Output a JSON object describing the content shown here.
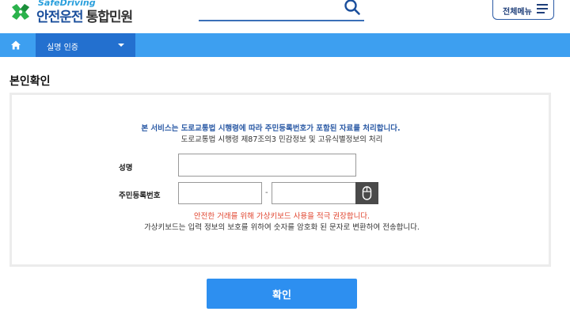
{
  "header": {
    "logo_en": "SafeDriving",
    "logo_ko": "안전운전",
    "logo_sub": "통합민원",
    "search": {
      "value": "",
      "placeholder": ""
    },
    "menu_label": "전체메뉴"
  },
  "nav": {
    "home_icon": "home-icon",
    "selected": "실명 인증"
  },
  "page": {
    "title": "본인확인"
  },
  "form": {
    "notice_primary": "본 서비스는 도로교통법 시행령에 따라 주민등록번호가 포함된 자료를 처리합니다.",
    "notice_secondary": "도로교통법 시행령 제87조의3 민감정보 및 고유식별정보의 처리",
    "name_label": "성명",
    "name_value": "",
    "rrn_label": "주민등록번호",
    "rrn_front": "",
    "rrn_back": "",
    "rrn_separator": "-",
    "virtual_keyboard_icon": "mouse-icon",
    "warning": "안전한 거래를 위해 가상키보드 사용을 적극 권장합니다.",
    "info": "가상키보드는 입력 정보의 보호를 위하여 숫자를 암호화 된 문자로 변환하여 전송합니다."
  },
  "actions": {
    "confirm_label": "확인"
  },
  "colors": {
    "nav_bar": "#3d9ff0",
    "nav_selected": "#2370cf",
    "button": "#2d8ff0",
    "notice": "#2b5aa5",
    "warning": "#e0452f",
    "logo_green": "#2bb24c"
  }
}
